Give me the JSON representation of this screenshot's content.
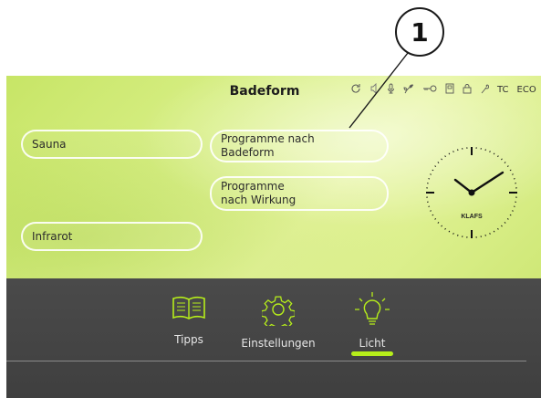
{
  "callout": {
    "number": "1"
  },
  "header": {
    "title": "Badeform"
  },
  "status": {
    "tc": "TC",
    "eco": "ECO"
  },
  "buttons": {
    "sauna": "Sauna",
    "infrarot": "Infrarot",
    "programme_badeform_1": "Programme nach",
    "programme_badeform_2": "Badeform",
    "programme_wirkung_1": "Programme",
    "programme_wirkung_2": "nach Wirkung"
  },
  "clock": {
    "brand": "KLAFS"
  },
  "dock": {
    "items": [
      {
        "label": "Tipps",
        "icon": "book-icon"
      },
      {
        "label": "Einstellungen",
        "icon": "gear-icon"
      },
      {
        "label": "Licht",
        "icon": "lightbulb-icon"
      }
    ]
  },
  "colors": {
    "accent": "#b6ee1a",
    "panel": "#d8ef86",
    "dock": "#444444"
  }
}
